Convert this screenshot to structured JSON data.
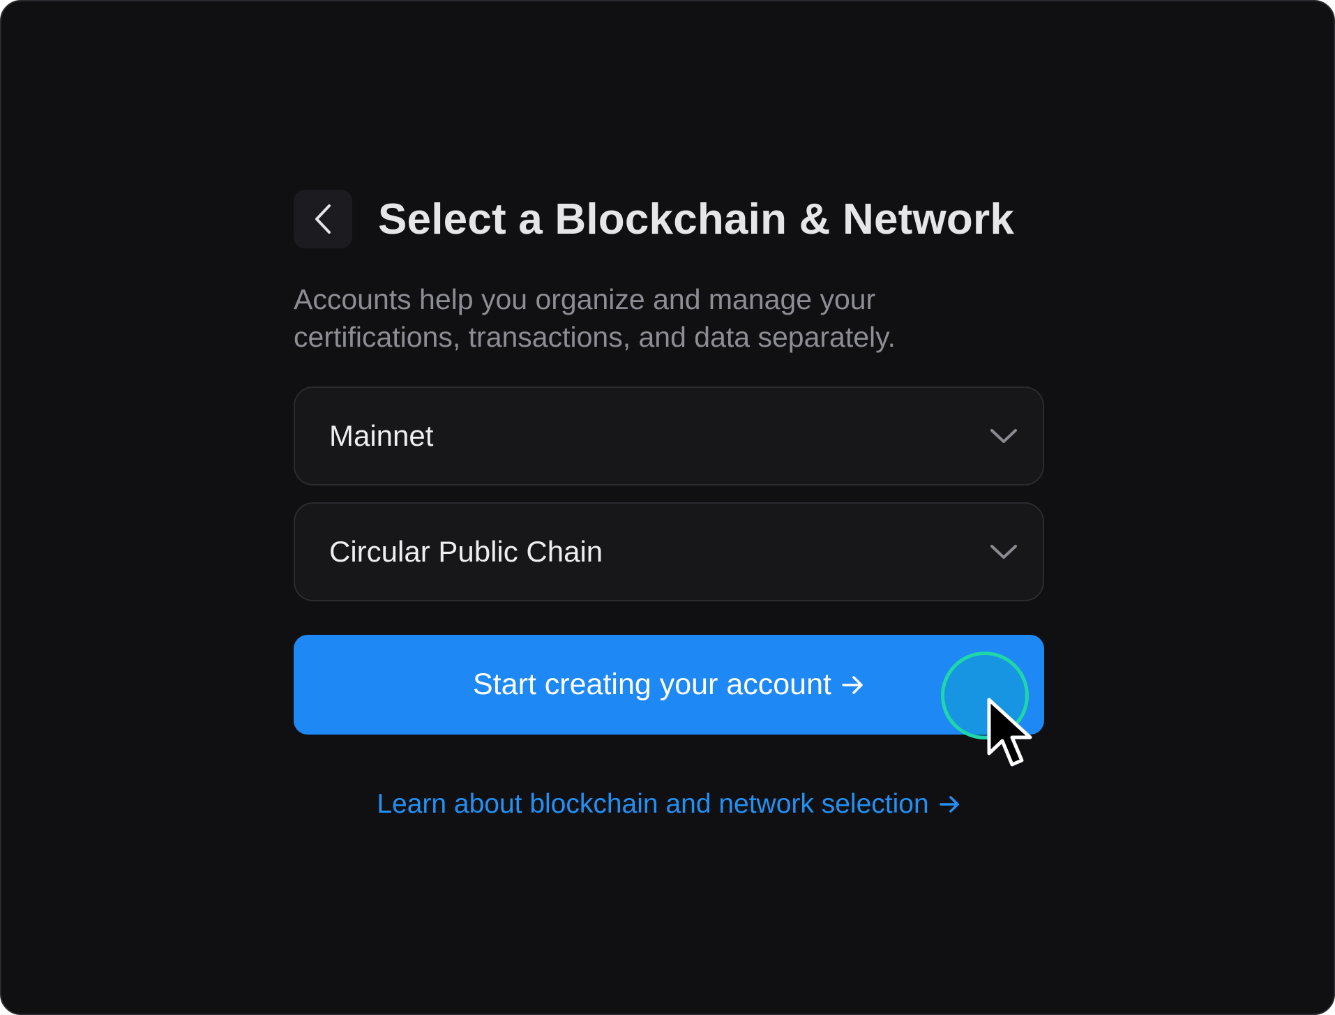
{
  "header": {
    "title": "Select a Blockchain & Network",
    "back_icon": "chevron-left-icon"
  },
  "subtitle": {
    "line1": "Accounts help you organize and manage your",
    "line2": "certifications, transactions, and data separately."
  },
  "network_select": {
    "value": "Mainnet",
    "icon": "chevron-down-icon"
  },
  "blockchain_select": {
    "value": "Circular Public Chain",
    "icon": "chevron-down-icon"
  },
  "primary_button": {
    "label": "Start creating your account",
    "icon": "arrow-right-icon"
  },
  "learn_link": {
    "label": "Learn about blockchain and network selection",
    "icon": "arrow-right-icon"
  },
  "colors": {
    "background": "#101013",
    "accent": "#1e88f5",
    "link": "#2390f3",
    "cursor_ring": "#1fd7a8"
  }
}
